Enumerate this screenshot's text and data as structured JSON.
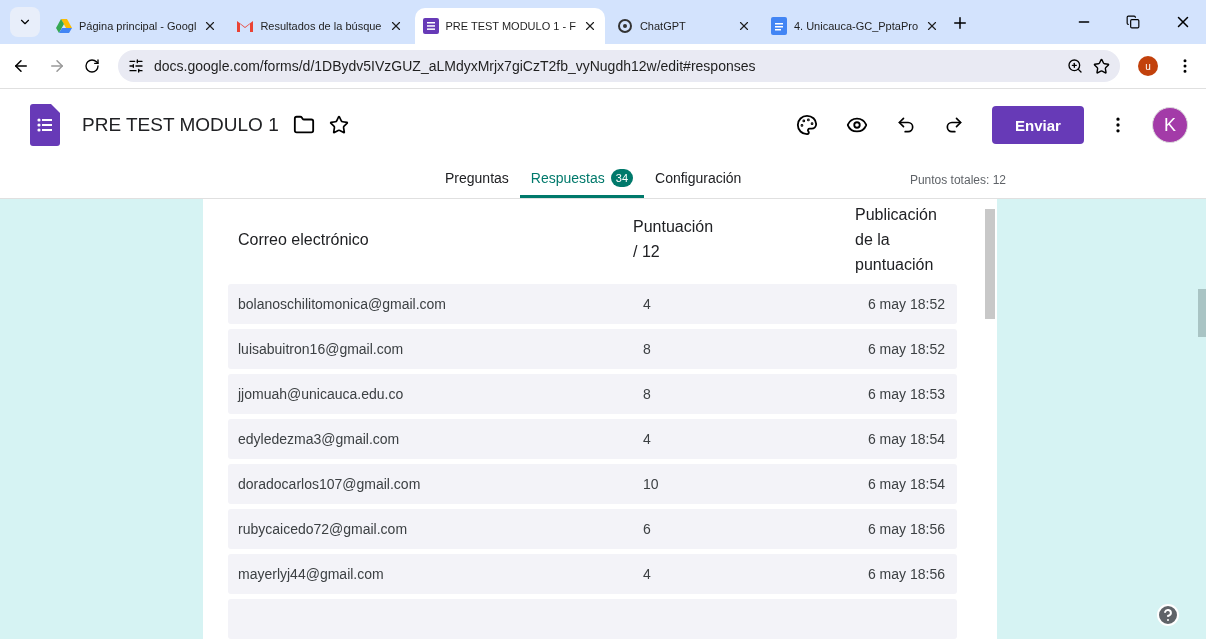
{
  "browser_tabs": [
    {
      "title": "Página principal - Googl",
      "selected": false
    },
    {
      "title": "Resultados de la búsque",
      "selected": false
    },
    {
      "title": "PRE TEST MODULO 1 - F",
      "selected": true
    },
    {
      "title": "ChatGPT",
      "selected": false
    },
    {
      "title": "4. Unicauca-GC_PptaPro",
      "selected": false
    }
  ],
  "address_bar": {
    "url": "docs.google.com/forms/d/1DBydv5IVzGUZ_aLMdyxMrjx7giCzT2fb_vyNugdh12w/edit#responses"
  },
  "profile_initial": "u",
  "form": {
    "title": "PRE TEST MODULO 1",
    "send_button": "Enviar",
    "account_initial": "K"
  },
  "form_tabs": [
    {
      "label": "Preguntas",
      "selected": false
    },
    {
      "label": "Respuestas",
      "badge": "34",
      "selected": true
    },
    {
      "label": "Configuración",
      "selected": false
    }
  ],
  "total_points": "Puntos totales: 12",
  "table": {
    "columns": [
      "Correo electrónico",
      "Puntuación\n/ 12",
      "Publicación\nde la\npuntuación"
    ],
    "rows": [
      {
        "email": "bolanoschilitomonica@gmail.com",
        "score": "4",
        "published": "6 may 18:52"
      },
      {
        "email": "luisabuitron16@gmail.com",
        "score": "8",
        "published": "6 may 18:52"
      },
      {
        "email": "jjomuah@unicauca.edu.co",
        "score": "8",
        "published": "6 may 18:53"
      },
      {
        "email": "edyledezma3@gmail.com",
        "score": "4",
        "published": "6 may 18:54"
      },
      {
        "email": "doradocarlos107@gmail.com",
        "score": "10",
        "published": "6 may 18:54"
      },
      {
        "email": "rubycaicedo72@gmail.com",
        "score": "6",
        "published": "6 may 18:56"
      },
      {
        "email": "mayerlyj44@gmail.com",
        "score": "4",
        "published": "6 may 18:56"
      }
    ]
  }
}
